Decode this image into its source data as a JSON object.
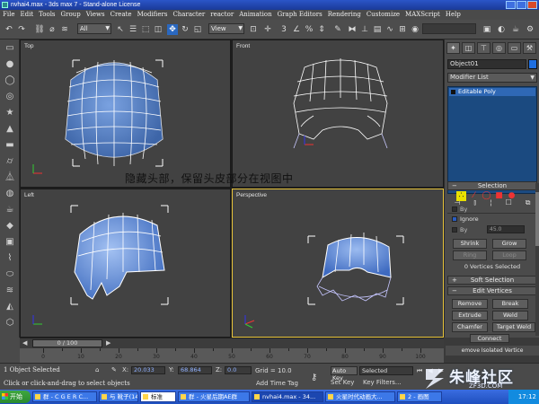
{
  "window": {
    "title": "nvhai4.max - 3ds max 7 - Stand-alone License"
  },
  "menu": [
    "File",
    "Edit",
    "Tools",
    "Group",
    "Views",
    "Create",
    "Modifiers",
    "Character",
    "reactor",
    "Animation",
    "Graph Editors",
    "Rendering",
    "Customize",
    "MAXScript",
    "Help"
  ],
  "toolbar": {
    "selection_filter": "All",
    "reference_coord": "View"
  },
  "viewports": {
    "top_label": "Top",
    "front_label": "Front",
    "left_label": "Left",
    "perspective_label": "Perspective",
    "caption": "隐藏头部，保留头皮部分在视图中"
  },
  "command_panel": {
    "object_name": "Object01",
    "modifier_list": "Modifier List",
    "stack_item": "Editable Poly",
    "object_color": "#1f6fe0",
    "selection_rollout": "Selection",
    "by_vertex_label": "By",
    "ignore_backfacing_label": "Ignore",
    "by_angle_label": "By",
    "angle_value": "45.0",
    "shrink_label": "Shrink",
    "grow_label": "Grow",
    "ring_label": "Ring",
    "loop_label": "Loop",
    "selection_info": "0 Vertices Selected",
    "soft_selection_rollout": "Soft Selection",
    "edit_vertices_rollout": "Edit Vertices",
    "remove_label": "Remove",
    "break_label": "Break",
    "extrude_label": "Extrude",
    "weld_label": "Weld",
    "chamfer_label": "Chamfer",
    "target_weld_label": "Target Weld",
    "connect_label": "Connect",
    "remove_isolated_label": "emove Isolated Vertice"
  },
  "timeline": {
    "frame_display": "0 / 100",
    "ticks": [
      "0",
      "10",
      "20",
      "30",
      "40",
      "50",
      "60",
      "70",
      "80",
      "90",
      "100"
    ]
  },
  "status": {
    "selection_count": "1 Object Selected",
    "prompt": "Click or click-and-drag to select objects",
    "x_label": "X:",
    "x_value": "20.033",
    "y_label": "Y:",
    "y_value": "68.864",
    "z_label": "Z:",
    "z_value": "0.0",
    "grid": "Grid = 10.0",
    "add_time_tag": "Add Time Tag",
    "auto_key": "Auto Key",
    "selected": "Selected",
    "set_key": "Set Key",
    "key_filters": "Key Filters..."
  },
  "watermark": {
    "text": "朱峰社区",
    "url": "ZF3D.COM"
  },
  "taskbar": {
    "start": "开始",
    "tasks": [
      "群 - C G E R C...",
      "与 靴子(148天)",
      "标准",
      "群 - 火星后期AE群",
      "nvhai4.max - 34...",
      "火星时代动画大...",
      "2 - 画图"
    ],
    "clock": "17:12"
  }
}
